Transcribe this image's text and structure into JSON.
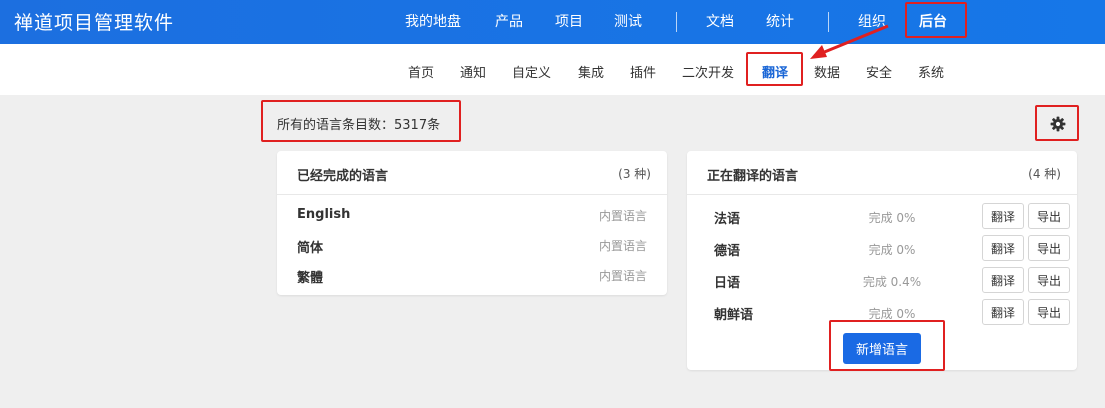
{
  "app": {
    "title": "禅道项目管理软件"
  },
  "topnav": {
    "items": [
      "我的地盘",
      "产品",
      "项目",
      "测试",
      "文档",
      "统计",
      "组织",
      "后台"
    ]
  },
  "subnav": {
    "items": [
      "首页",
      "通知",
      "自定义",
      "集成",
      "插件",
      "二次开发",
      "翻译",
      "数据",
      "安全",
      "系统"
    ]
  },
  "summary": {
    "text": "所有的语言条目数：5317条"
  },
  "completed": {
    "title": "已经完成的语言",
    "count": "(3 种)",
    "items": [
      {
        "name": "English",
        "note": "内置语言"
      },
      {
        "name": "简体",
        "note": "内置语言"
      },
      {
        "name": "繁體",
        "note": "内置语言"
      }
    ]
  },
  "translating": {
    "title": "正在翻译的语言",
    "count": "(4 种)",
    "translate_label": "翻译",
    "export_label": "导出",
    "items": [
      {
        "name": "法语",
        "progress": "完成 0%"
      },
      {
        "name": "德语",
        "progress": "完成 0%"
      },
      {
        "name": "日语",
        "progress": "完成 0.4%"
      },
      {
        "name": "朝鲜语",
        "progress": "完成 0%"
      }
    ],
    "add_label": "新增语言"
  },
  "colors": {
    "topbar": "#1a73e8",
    "accent": "#1a6ae4",
    "highlight": "#e02020"
  },
  "icons": {
    "settings": "gear-icon",
    "pointer": "arrow-icon"
  }
}
